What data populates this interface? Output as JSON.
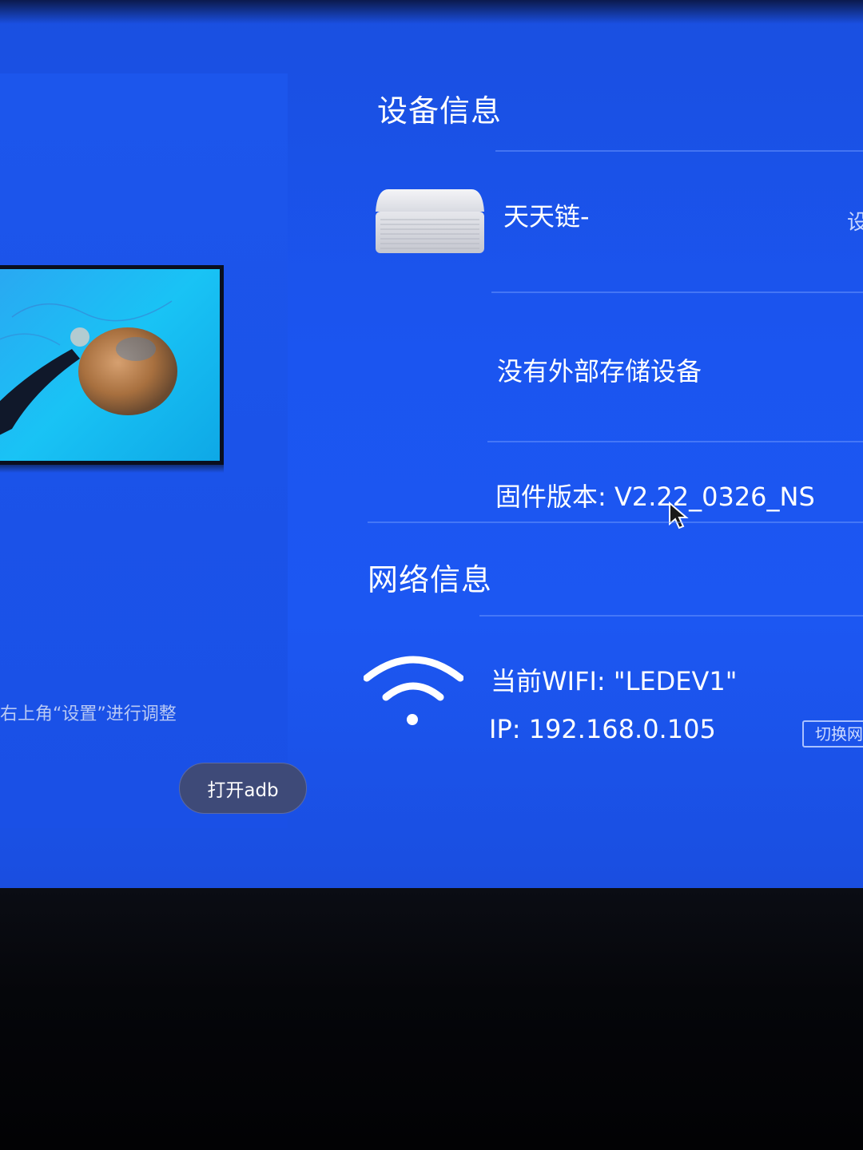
{
  "left_panel": {
    "caption": "右上角“设置”进行调整",
    "adb_button_label": "打开adb"
  },
  "device_section": {
    "title": "设备信息",
    "device_name": "天天链-",
    "edge_text": "设",
    "storage_text": "没有外部存储设备",
    "firmware_text": "固件版本: V2.22_0326_NS"
  },
  "network_section": {
    "title": "网络信息",
    "wifi_text": "当前WIFI: \"LEDEV1\"",
    "ip_text": "IP: 192.168.0.105",
    "switch_button_label": "切换网"
  },
  "colors": {
    "screen_blue": "#1b55f0",
    "button_bg": "#3e4a78"
  }
}
